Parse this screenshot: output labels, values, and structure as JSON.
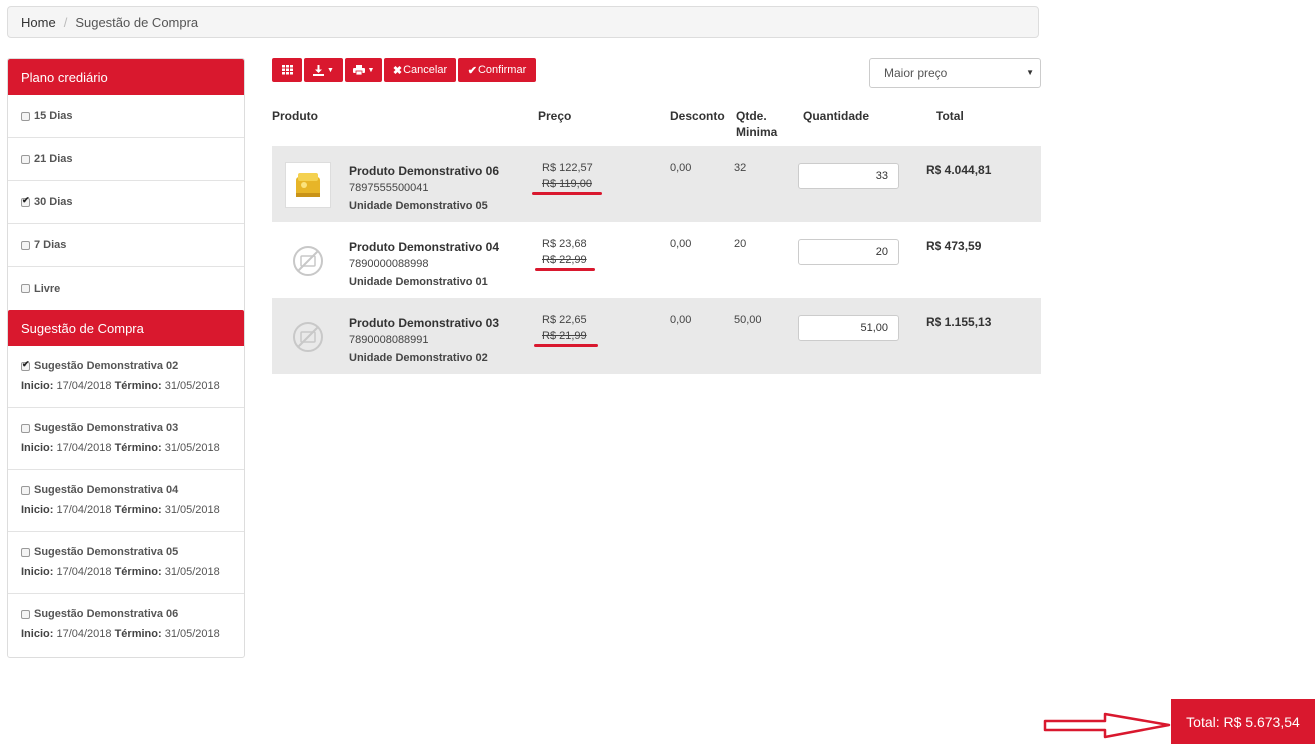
{
  "breadcrumb": {
    "home": "Home",
    "separator": "/",
    "current": "Sugestão de Compra"
  },
  "sidebar": {
    "plan_title": "Plano crediário",
    "plans": [
      {
        "label": "15 Dias",
        "checked": false
      },
      {
        "label": "21 Dias",
        "checked": false
      },
      {
        "label": "30 Dias",
        "checked": true
      },
      {
        "label": "7 Dias",
        "checked": false
      },
      {
        "label": "Livre",
        "checked": false
      }
    ],
    "suggestion_title": "Sugestão de Compra",
    "start_label": "Inicio:",
    "end_label": "Término:",
    "suggestions": [
      {
        "name": "Sugestão Demonstrativa 02",
        "start": "17/04/2018",
        "end": "31/05/2018",
        "checked": true
      },
      {
        "name": "Sugestão Demonstrativa 03",
        "start": "17/04/2018",
        "end": "31/05/2018",
        "checked": false
      },
      {
        "name": "Sugestão Demonstrativa 04",
        "start": "17/04/2018",
        "end": "31/05/2018",
        "checked": false
      },
      {
        "name": "Sugestão Demonstrativa 05",
        "start": "17/04/2018",
        "end": "31/05/2018",
        "checked": false
      },
      {
        "name": "Sugestão Demonstrativa 06",
        "start": "17/04/2018",
        "end": "31/05/2018",
        "checked": false
      }
    ]
  },
  "toolbar": {
    "grid_icon": "grid-icon",
    "download_icon": "download-icon",
    "print_icon": "print-icon",
    "cancel_label": "Cancelar",
    "confirm_label": "Confirmar"
  },
  "sort": {
    "selected": "Maior preço"
  },
  "table": {
    "headers": {
      "product": "Produto",
      "price": "Preço",
      "discount": "Desconto",
      "min_qty_line1": "Qtde.",
      "min_qty_line2": "Minima",
      "quantity": "Quantidade",
      "total": "Total"
    },
    "rows": [
      {
        "name": "Produto Demonstrativo 06",
        "code": "7897555500041",
        "unit": "Unidade Demonstrativo 05",
        "price": "R$ 122,57",
        "old_price": "R$ 119,00",
        "discount": "0,00",
        "min_qty": "32",
        "quantity": "33",
        "total": "R$ 4.044,81",
        "image": "product-photo"
      },
      {
        "name": "Produto Demonstrativo 04",
        "code": "7890000088998",
        "unit": "Unidade Demonstrativo 01",
        "price": "R$ 23,68",
        "old_price": "R$ 22,99",
        "discount": "0,00",
        "min_qty": "20",
        "quantity": "20",
        "total": "R$ 473,59",
        "image": "no-image"
      },
      {
        "name": "Produto Demonstrativo 03",
        "code": "7890008088991",
        "unit": "Unidade Demonstrativo 02",
        "price": "R$ 22,65",
        "old_price": "R$ 21,99",
        "discount": "0,00",
        "min_qty": "50,00",
        "quantity": "51,00",
        "total": "R$ 1.155,13",
        "image": "no-image"
      }
    ]
  },
  "footer": {
    "total": "Total: R$ 5.673,54"
  },
  "colors": {
    "accent": "#d9182e",
    "row_alt": "#e9e9e9"
  }
}
